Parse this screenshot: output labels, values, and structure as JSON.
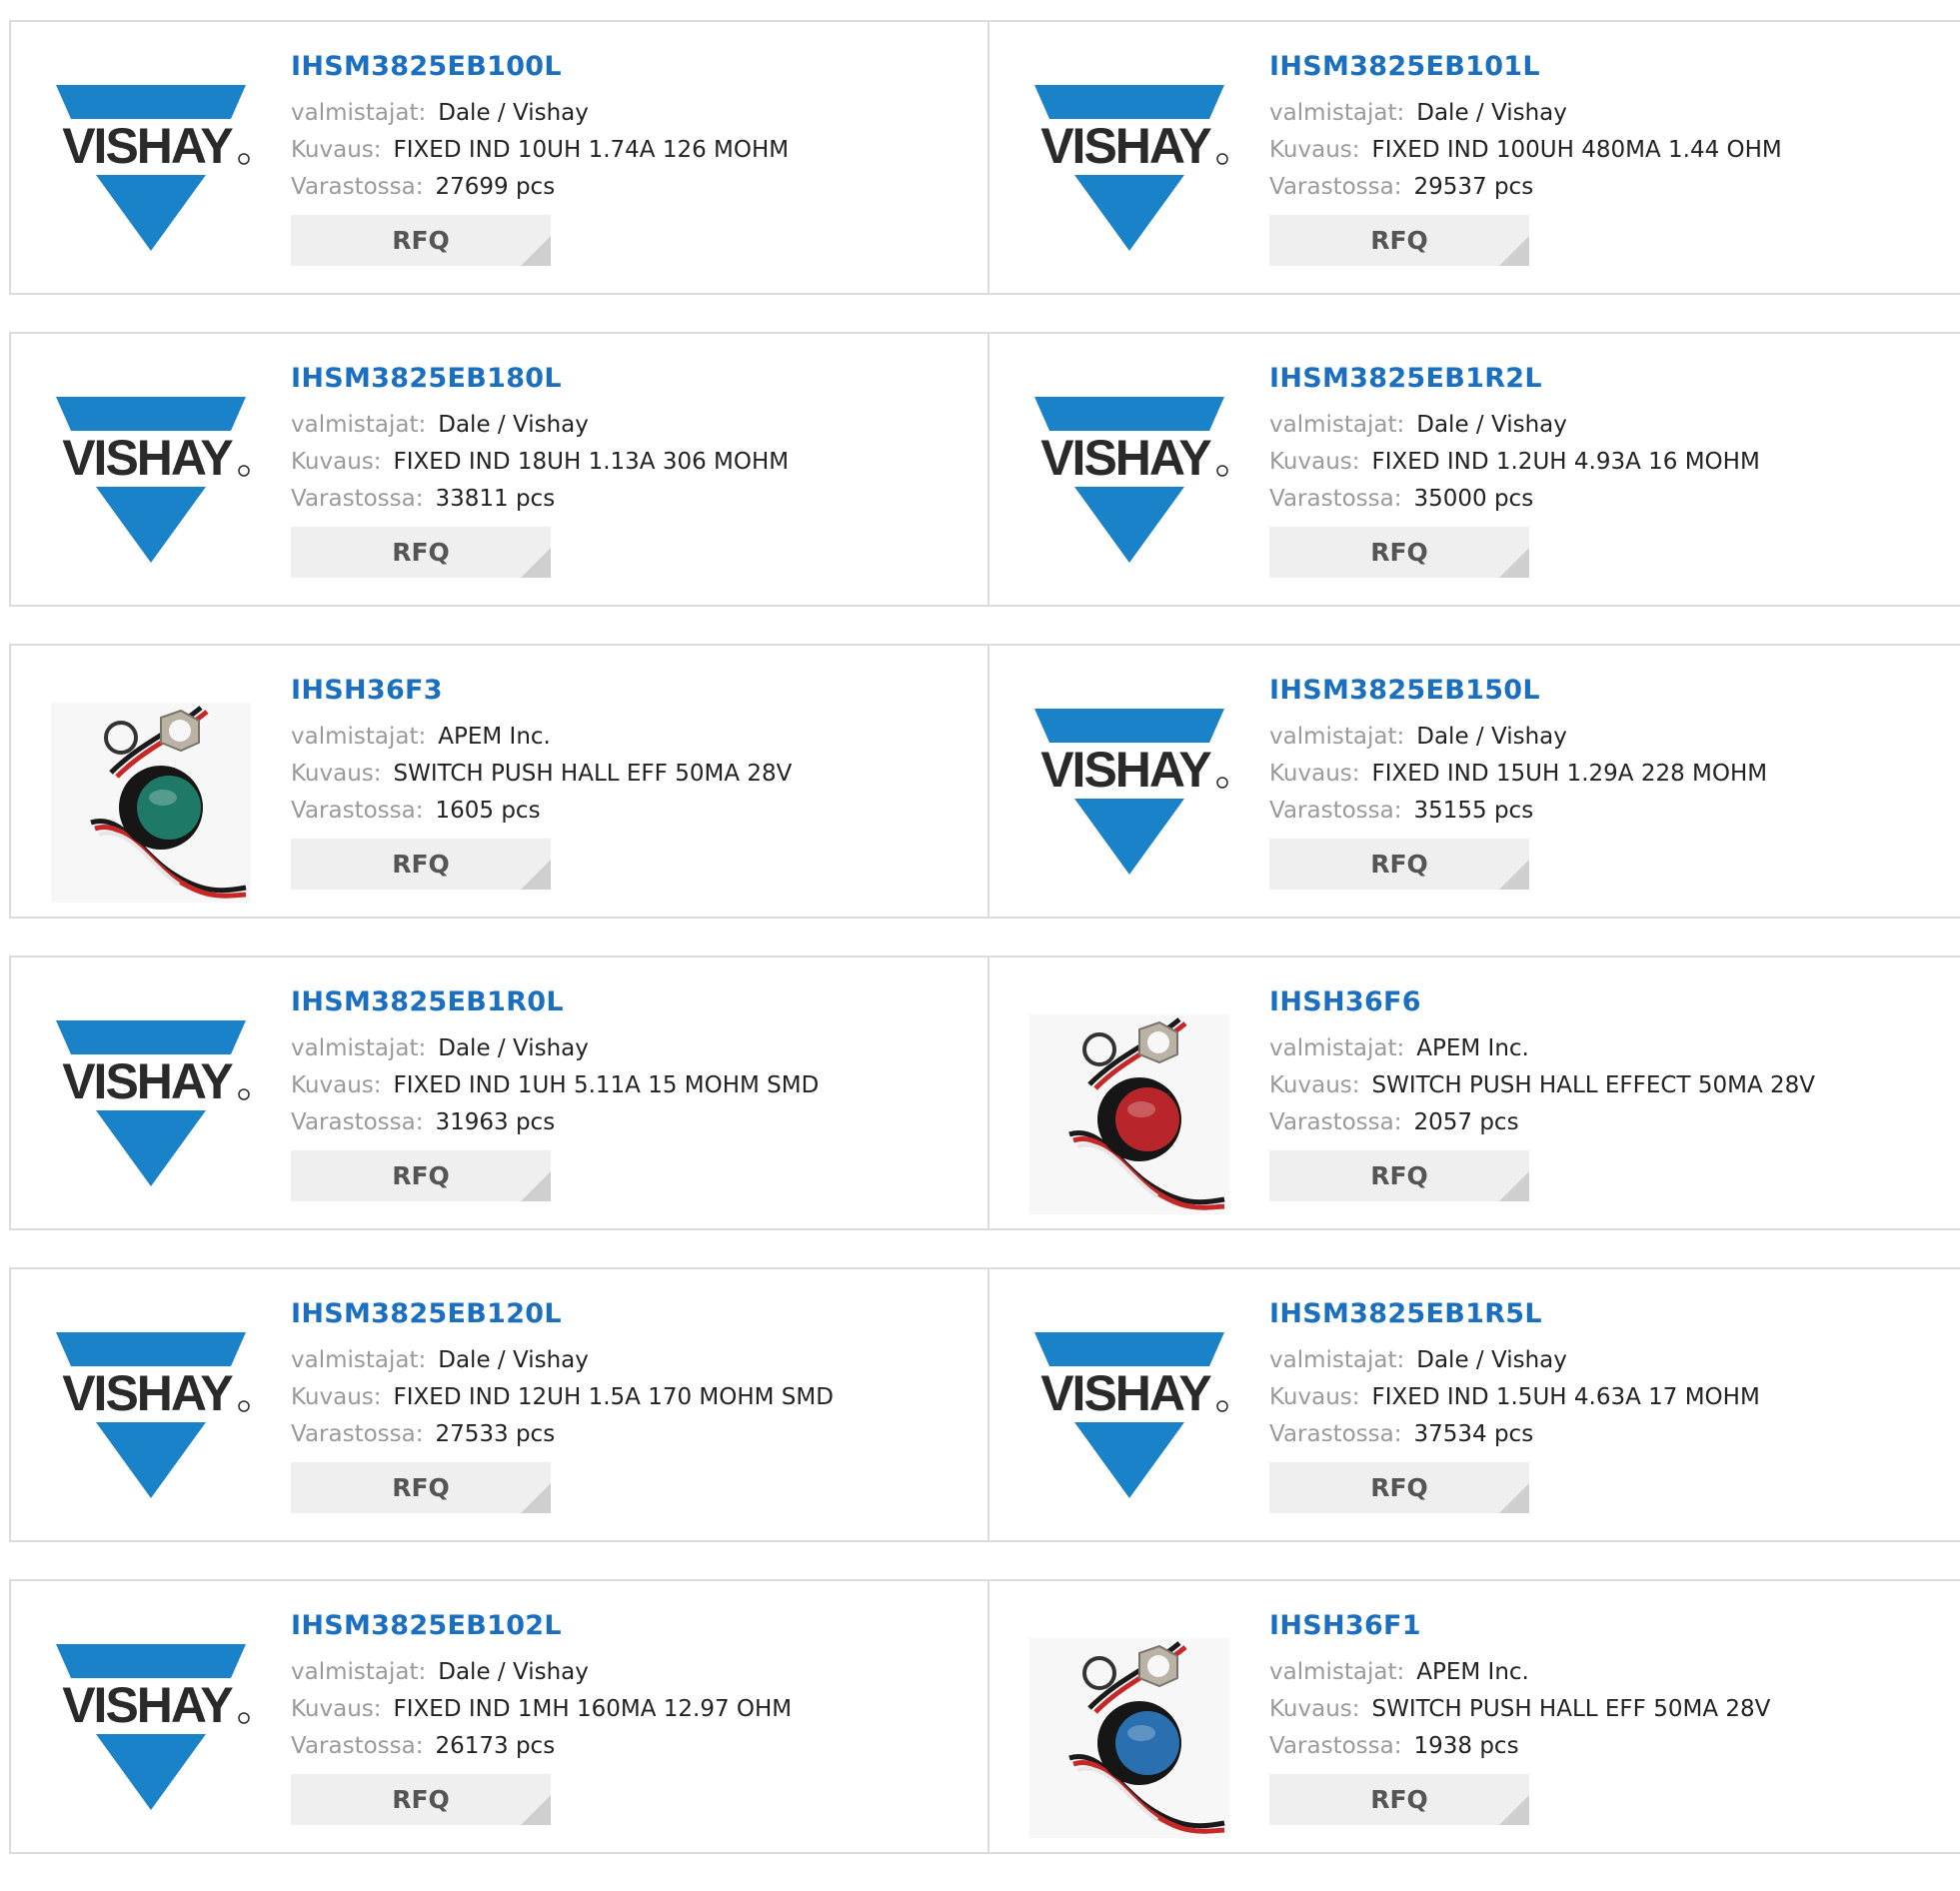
{
  "labels": {
    "manufacturer": "valmistajat:",
    "description": "Kuvaus:",
    "stock": "Varastossa:",
    "rfq": "RFQ"
  },
  "colors": {
    "vishay_blue": "#1a82c9",
    "link_blue": "#1a6fc0",
    "label_gray": "#9a9a9a",
    "button_bg": "#efefef"
  },
  "logo_text": "VISHAY",
  "products": [
    {
      "part": "IHSM3825EB100L",
      "manufacturer": "Dale / Vishay",
      "description": "FIXED IND 10UH 1.74A 126 MOHM",
      "stock": "27699 pcs",
      "image": "vishay-logo"
    },
    {
      "part": "IHSM3825EB101L",
      "manufacturer": "Dale / Vishay",
      "description": "FIXED IND 100UH 480MA 1.44 OHM",
      "stock": "29537 pcs",
      "image": "vishay-logo"
    },
    {
      "part": "IHSM3825EB180L",
      "manufacturer": "Dale / Vishay",
      "description": "FIXED IND 18UH 1.13A 306 MOHM",
      "stock": "33811 pcs",
      "image": "vishay-logo"
    },
    {
      "part": "IHSM3825EB1R2L",
      "manufacturer": "Dale / Vishay",
      "description": "FIXED IND 1.2UH 4.93A 16 MOHM",
      "stock": "35000 pcs",
      "image": "vishay-logo"
    },
    {
      "part": "IHSH36F3",
      "manufacturer": "APEM Inc.",
      "description": "SWITCH PUSH HALL EFF 50MA 28V",
      "stock": "1605 pcs",
      "image": "pushbutton-switch-green"
    },
    {
      "part": "IHSM3825EB150L",
      "manufacturer": "Dale / Vishay",
      "description": "FIXED IND 15UH 1.29A 228 MOHM",
      "stock": "35155 pcs",
      "image": "vishay-logo"
    },
    {
      "part": "IHSM3825EB1R0L",
      "manufacturer": "Dale / Vishay",
      "description": "FIXED IND 1UH 5.11A 15 MOHM SMD",
      "stock": "31963 pcs",
      "image": "vishay-logo"
    },
    {
      "part": "IHSH36F6",
      "manufacturer": "APEM Inc.",
      "description": "SWITCH PUSH HALL EFFECT 50MA 28V",
      "stock": "2057 pcs",
      "image": "pushbutton-switch-red"
    },
    {
      "part": "IHSM3825EB120L",
      "manufacturer": "Dale / Vishay",
      "description": "FIXED IND 12UH 1.5A 170 MOHM SMD",
      "stock": "27533 pcs",
      "image": "vishay-logo"
    },
    {
      "part": "IHSM3825EB1R5L",
      "manufacturer": "Dale / Vishay",
      "description": "FIXED IND 1.5UH 4.63A 17 MOHM",
      "stock": "37534 pcs",
      "image": "vishay-logo"
    },
    {
      "part": "IHSM3825EB102L",
      "manufacturer": "Dale / Vishay",
      "description": "FIXED IND 1MH 160MA 12.97 OHM",
      "stock": "26173 pcs",
      "image": "vishay-logo"
    },
    {
      "part": "IHSH36F1",
      "manufacturer": "APEM Inc.",
      "description": "SWITCH PUSH HALL EFF 50MA 28V",
      "stock": "1938 pcs",
      "image": "pushbutton-switch-blue"
    }
  ]
}
